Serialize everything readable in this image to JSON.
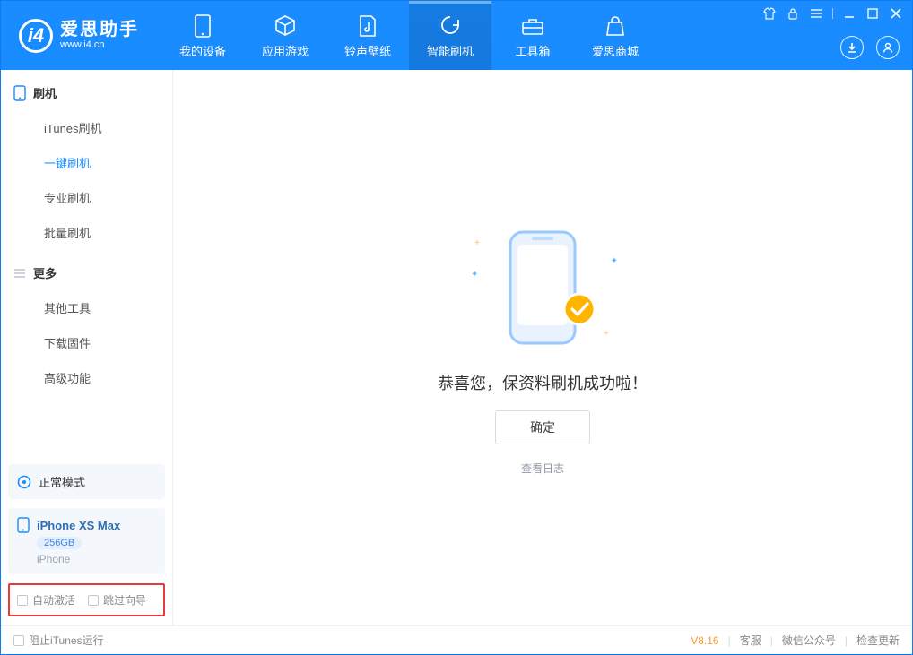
{
  "app": {
    "title": "爱思助手",
    "url": "www.i4.cn"
  },
  "nav": {
    "items": [
      {
        "label": "我的设备"
      },
      {
        "label": "应用游戏"
      },
      {
        "label": "铃声壁纸"
      },
      {
        "label": "智能刷机"
      },
      {
        "label": "工具箱"
      },
      {
        "label": "爱思商城"
      }
    ]
  },
  "sidebar": {
    "group1": {
      "title": "刷机",
      "items": [
        "iTunes刷机",
        "一键刷机",
        "专业刷机",
        "批量刷机"
      ]
    },
    "group2": {
      "title": "更多",
      "items": [
        "其他工具",
        "下载固件",
        "高级功能"
      ]
    },
    "mode": {
      "label": "正常模式"
    },
    "device": {
      "name": "iPhone XS Max",
      "capacity": "256GB",
      "type": "iPhone"
    },
    "checks": {
      "autoActivate": "自动激活",
      "skipGuide": "跳过向导"
    }
  },
  "main": {
    "message": "恭喜您，保资料刷机成功啦！",
    "ok": "确定",
    "viewLog": "查看日志"
  },
  "footer": {
    "blockItunes": "阻止iTunes运行",
    "version": "V8.16",
    "service": "客服",
    "wechat": "微信公众号",
    "update": "检查更新"
  }
}
